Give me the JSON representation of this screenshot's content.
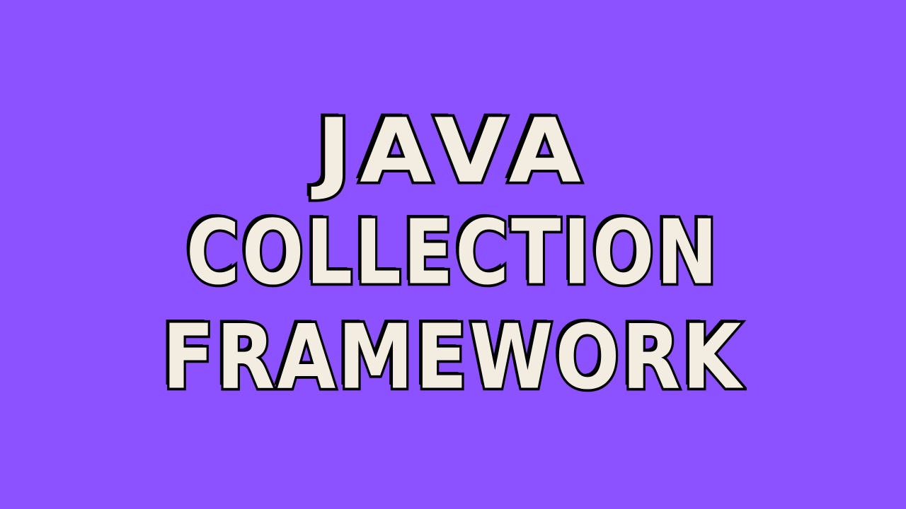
{
  "title": {
    "lines": [
      "JAVA",
      "COLLECTION",
      "FRAMEWORK"
    ]
  },
  "colors": {
    "background": "#8c52ff",
    "text_fill": "#f2ede0",
    "text_outline": "#000000"
  }
}
